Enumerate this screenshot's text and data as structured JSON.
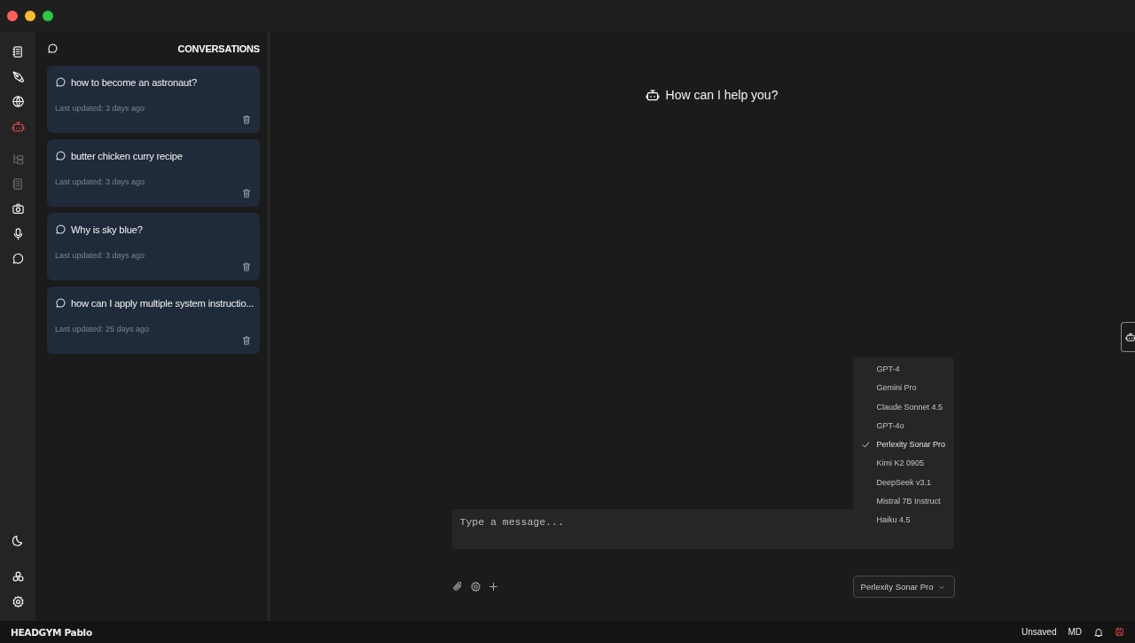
{
  "rail": {
    "top": [
      {
        "kind": "notebook",
        "selected": false,
        "disabled": false
      },
      {
        "kind": "pen",
        "selected": false,
        "disabled": false
      },
      {
        "kind": "globe",
        "selected": false,
        "disabled": false
      },
      {
        "kind": "robot",
        "selected": true,
        "disabled": false
      },
      {
        "kind": "tree",
        "selected": false,
        "disabled": true
      },
      {
        "kind": "notebook",
        "selected": false,
        "disabled": true
      },
      {
        "kind": "camera",
        "selected": false,
        "disabled": false
      },
      {
        "kind": "mic",
        "selected": false,
        "disabled": false
      },
      {
        "kind": "chat",
        "selected": false,
        "disabled": false
      }
    ],
    "bottom": [
      {
        "kind": "moon",
        "selected": false,
        "disabled": false
      },
      {
        "kind": "cluster",
        "selected": false,
        "disabled": false
      },
      {
        "kind": "gear",
        "selected": false,
        "disabled": false
      }
    ]
  },
  "conversations": {
    "title": "CONVERSATIONS",
    "items": [
      {
        "title": "how to become an astronaut?",
        "updated": "Last updated: 3 days ago"
      },
      {
        "title": "butter chicken curry recipe",
        "updated": "Last updated: 3 days ago"
      },
      {
        "title": "Why is sky blue?",
        "updated": "Last updated: 3 days ago"
      },
      {
        "title": "how can I apply multiple system instructio...",
        "updated": "Last updated: 25 days ago"
      }
    ]
  },
  "chat": {
    "greeting": "How can I help you?",
    "input": {
      "placeholder": "Type a message..."
    },
    "models": [
      {
        "label": "GPT-4",
        "selected": false
      },
      {
        "label": "Gemini Pro",
        "selected": false
      },
      {
        "label": "Claude Sonnet 4.5",
        "selected": false
      },
      {
        "label": "GPT-4o",
        "selected": false
      },
      {
        "label": "Perlexity Sonar Pro",
        "selected": true
      },
      {
        "label": "Kimi K2 0905",
        "selected": false
      },
      {
        "label": "DeepSeek v3.1",
        "selected": false
      },
      {
        "label": "Mistral 7B Instruct",
        "selected": false
      },
      {
        "label": "Haiku 4.5",
        "selected": false
      }
    ],
    "model_select": "Perlexity Sonar Pro"
  },
  "status_bar": {
    "brand": "HEADGYM Pablo",
    "save_state": "Unsaved",
    "format": "MD"
  }
}
